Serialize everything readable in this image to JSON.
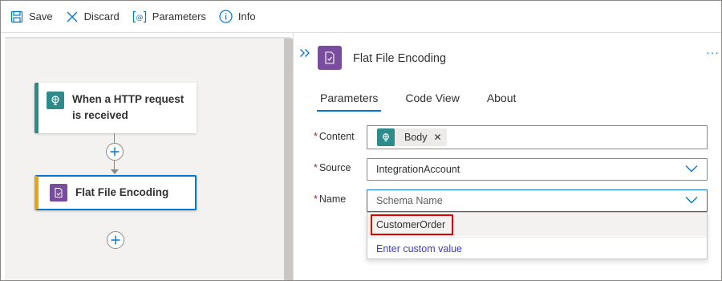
{
  "toolbar": {
    "save_label": "Save",
    "discard_label": "Discard",
    "parameters_label": "Parameters",
    "info_label": "Info"
  },
  "canvas": {
    "trigger_title_line1": "When a HTTP request",
    "trigger_title_line2": "is received",
    "action_title": "Flat File Encoding"
  },
  "panel": {
    "title": "Flat File Encoding",
    "more_label": "···",
    "tabs": [
      {
        "label": "Parameters",
        "active": true
      },
      {
        "label": "Code View",
        "active": false
      },
      {
        "label": "About",
        "active": false
      }
    ],
    "fields": {
      "content_label": "Content",
      "content_token": "Body",
      "source_label": "Source",
      "source_value": "IntegrationAccount",
      "name_label": "Name",
      "name_placeholder": "Schema Name"
    },
    "dropdown_options": [
      {
        "label": "CustomerOrder",
        "highlighted": true
      },
      {
        "label": "Enter custom value",
        "highlighted": false
      }
    ]
  },
  "colors": {
    "accent": "#0078d4",
    "trigger_color": "#2e8b8b",
    "action_color": "#7a4c9e",
    "action_border": "#e8a317",
    "highlight_box": "#e00000",
    "required_mark": "#a4262c"
  }
}
